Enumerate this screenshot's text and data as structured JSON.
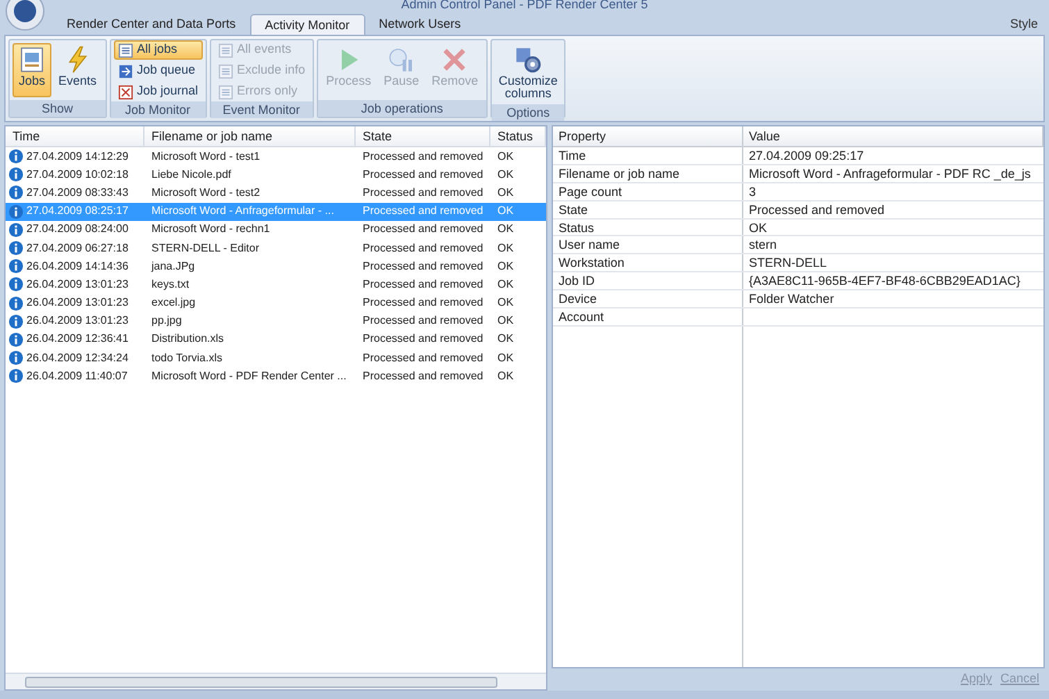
{
  "window": {
    "title": "Admin Control Panel - PDF Render Center 5"
  },
  "tabs": [
    {
      "label": "Render Center and Data Ports",
      "selected": false
    },
    {
      "label": "Activity Monitor",
      "selected": true
    },
    {
      "label": "Network Users",
      "selected": false
    }
  ],
  "style_menu": "Style",
  "ribbon": [
    {
      "label": "Show",
      "kind": "large",
      "items": [
        {
          "label": "Jobs",
          "selected": true,
          "disabled": false
        },
        {
          "label": "Events",
          "selected": false,
          "disabled": false
        }
      ]
    },
    {
      "label": "Job Monitor",
      "kind": "small",
      "items": [
        {
          "label": "All jobs",
          "selected": true,
          "disabled": false
        },
        {
          "label": "Job queue",
          "selected": false,
          "disabled": false
        },
        {
          "label": "Job journal",
          "selected": false,
          "disabled": false
        }
      ]
    },
    {
      "label": "Event Monitor",
      "kind": "small",
      "items": [
        {
          "label": "All events",
          "selected": false,
          "disabled": true
        },
        {
          "label": "Exclude info",
          "selected": false,
          "disabled": true
        },
        {
          "label": "Errors only",
          "selected": false,
          "disabled": true
        }
      ]
    },
    {
      "label": "Job operations",
      "kind": "large",
      "items": [
        {
          "label": "Process",
          "selected": false,
          "disabled": true
        },
        {
          "label": "Pause",
          "selected": false,
          "disabled": true
        },
        {
          "label": "Remove",
          "selected": false,
          "disabled": true
        }
      ]
    },
    {
      "label": "Options",
      "kind": "large",
      "items": [
        {
          "label": "Customize columns",
          "selected": false,
          "disabled": false
        }
      ]
    }
  ],
  "table": {
    "columns": [
      "Time",
      "Filename or job name",
      "State",
      "Status"
    ],
    "rows": [
      {
        "time": "27.04.2009 14:12:29",
        "name": "Microsoft Word - test1",
        "state": "Processed and removed",
        "status": "OK",
        "selected": false
      },
      {
        "time": "27.04.2009 10:02:18",
        "name": "Liebe Nicole.pdf",
        "state": "Processed and removed",
        "status": "OK",
        "selected": false
      },
      {
        "time": "27.04.2009 08:33:43",
        "name": "Microsoft Word - test2",
        "state": "Processed and removed",
        "status": "OK",
        "selected": false
      },
      {
        "time": "27.04.2009 08:25:17",
        "name": "Microsoft Word - Anfrageformular - ...",
        "state": "Processed and removed",
        "status": "OK",
        "selected": true
      },
      {
        "time": "27.04.2009 08:24:00",
        "name": "Microsoft Word - rechn1",
        "state": "Processed and removed",
        "status": "OK",
        "selected": false
      },
      {
        "time": "27.04.2009 06:27:18",
        "name": "STERN-DELL - Editor",
        "state": "Processed and removed",
        "status": "OK",
        "selected": false
      },
      {
        "time": "26.04.2009 14:14:36",
        "name": "jana.JPg",
        "state": "Processed and removed",
        "status": "OK",
        "selected": false
      },
      {
        "time": "26.04.2009 13:01:23",
        "name": "keys.txt",
        "state": "Processed and removed",
        "status": "OK",
        "selected": false
      },
      {
        "time": "26.04.2009 13:01:23",
        "name": "excel.jpg",
        "state": "Processed and removed",
        "status": "OK",
        "selected": false
      },
      {
        "time": "26.04.2009 13:01:23",
        "name": "pp.jpg",
        "state": "Processed and removed",
        "status": "OK",
        "selected": false
      },
      {
        "time": "26.04.2009 12:36:41",
        "name": "Distribution.xls",
        "state": "Processed and removed",
        "status": "OK",
        "selected": false
      },
      {
        "time": "26.04.2009 12:34:24",
        "name": "todo Torvia.xls",
        "state": "Processed and removed",
        "status": "OK",
        "selected": false
      },
      {
        "time": "26.04.2009 11:40:07",
        "name": "Microsoft Word - PDF Render Center ...",
        "state": "Processed and removed",
        "status": "OK",
        "selected": false
      }
    ]
  },
  "properties": {
    "columns": [
      "Property",
      "Value"
    ],
    "rows": [
      {
        "property": "Time",
        "value": "27.04.2009 09:25:17"
      },
      {
        "property": "Filename or job name",
        "value": "Microsoft Word - Anfrageformular - PDF RC _de_js"
      },
      {
        "property": "Page count",
        "value": "3"
      },
      {
        "property": "State",
        "value": "Processed and removed"
      },
      {
        "property": "Status",
        "value": "OK"
      },
      {
        "property": "User name",
        "value": "stern"
      },
      {
        "property": "Workstation",
        "value": "STERN-DELL"
      },
      {
        "property": "Job ID",
        "value": "{A3AE8C11-965B-4EF7-BF48-6CBB29EAD1AC}"
      },
      {
        "property": "Device",
        "value": "Folder Watcher"
      },
      {
        "property": "Account"
      }
    ]
  },
  "buttons": [
    "Apply",
    "Cancel"
  ]
}
